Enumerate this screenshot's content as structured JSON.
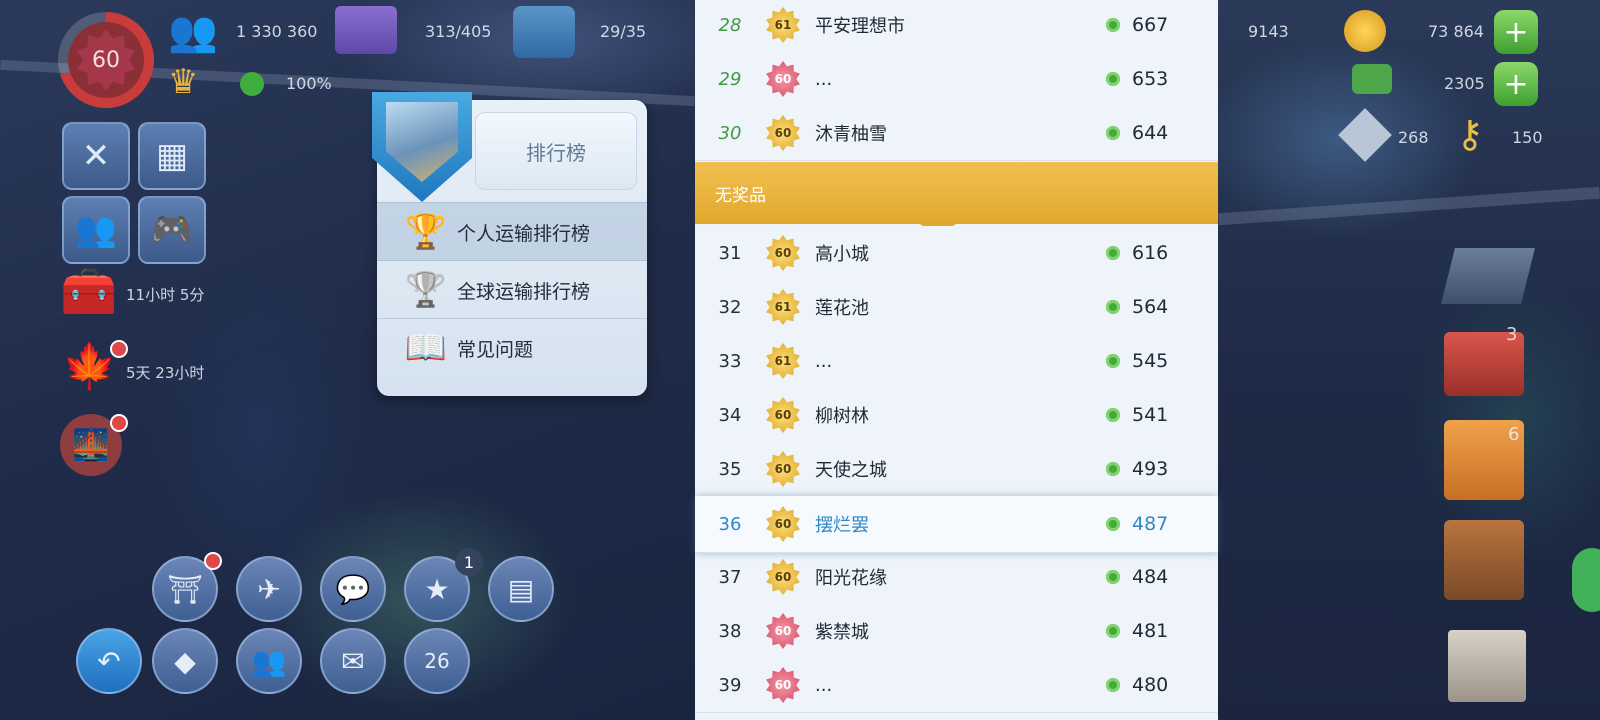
{
  "hud": {
    "level": "60",
    "population": "1 330 360",
    "buildings": "313/405",
    "storage": "29/35",
    "happiness": "100%",
    "simcash": "9143",
    "coins": "73 864",
    "extra": "2305",
    "tokens": "268",
    "keys": "150",
    "timer1": "11小时 5分",
    "timer2": "5天 23小时",
    "star_badge": "1",
    "bottom_badge": "26",
    "right_badge1": "3",
    "right_badge2": "6"
  },
  "menu": {
    "title": "排行榜",
    "items": [
      {
        "label": "个人运输排行榜",
        "icon": "gold-trophy-icon"
      },
      {
        "label": "全球运输排行榜",
        "icon": "silver-trophy-icon"
      },
      {
        "label": "常见问题",
        "icon": "faq-book-icon"
      }
    ]
  },
  "leaderboard": {
    "top_rows": [
      {
        "rank": "28",
        "level": "61",
        "color": "gold",
        "city": "平安理想市",
        "points": "667"
      },
      {
        "rank": "29",
        "level": "60",
        "color": "pink",
        "city": "...",
        "points": "653"
      },
      {
        "rank": "30",
        "level": "60",
        "color": "gold",
        "city": "沐青柚雪",
        "points": "644"
      }
    ],
    "section_label": "无奖品",
    "rows": [
      {
        "rank": "31",
        "level": "60",
        "color": "gold",
        "city": "高小城",
        "points": "616"
      },
      {
        "rank": "32",
        "level": "61",
        "color": "gold",
        "city": "莲花池",
        "points": "564"
      },
      {
        "rank": "33",
        "level": "61",
        "color": "gold",
        "city": "...",
        "points": "545"
      },
      {
        "rank": "34",
        "level": "60",
        "color": "gold",
        "city": "柳树林",
        "points": "541"
      },
      {
        "rank": "35",
        "level": "60",
        "color": "gold",
        "city": "天使之城",
        "points": "493"
      },
      {
        "rank": "36",
        "level": "60",
        "color": "gold",
        "city": "摆烂罢",
        "points": "487"
      },
      {
        "rank": "37",
        "level": "60",
        "color": "gold",
        "city": "阳光花缘",
        "points": "484"
      },
      {
        "rank": "38",
        "level": "60",
        "color": "pink",
        "city": "紫禁城",
        "points": "481"
      },
      {
        "rank": "39",
        "level": "60",
        "color": "pink",
        "city": "...",
        "points": "480"
      }
    ]
  }
}
